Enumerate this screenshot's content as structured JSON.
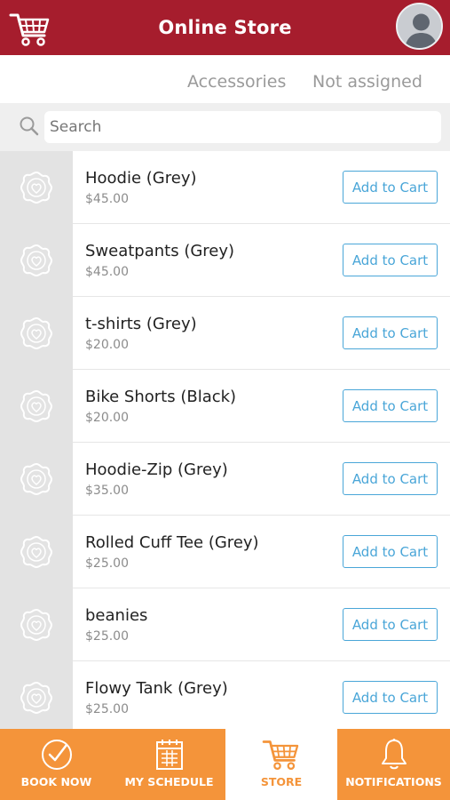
{
  "header": {
    "title": "Online Store",
    "cart_icon": "shopping-cart-icon",
    "avatar_icon": "user-avatar-icon"
  },
  "tabs": [
    {
      "label": "Accessories"
    },
    {
      "label": "Not assigned"
    }
  ],
  "search": {
    "placeholder": "Search",
    "value": "",
    "icon": "search-icon"
  },
  "products": [
    {
      "name": "Hoodie (Grey)",
      "price": "$45.00",
      "button": "Add to Cart"
    },
    {
      "name": "Sweatpants (Grey)",
      "price": "$45.00",
      "button": "Add to Cart"
    },
    {
      "name": "t-shirts (Grey)",
      "price": "$20.00",
      "button": "Add to Cart"
    },
    {
      "name": "Bike Shorts (Black)",
      "price": "$20.00",
      "button": "Add to Cart"
    },
    {
      "name": "Hoodie-Zip (Grey)",
      "price": "$35.00",
      "button": "Add to Cart"
    },
    {
      "name": "Rolled Cuff Tee (Grey)",
      "price": "$25.00",
      "button": "Add to Cart"
    },
    {
      "name": "beanies",
      "price": "$25.00",
      "button": "Add to Cart"
    },
    {
      "name": "Flowy Tank (Grey)",
      "price": "$25.00",
      "button": "Add to Cart"
    }
  ],
  "bottom_nav": [
    {
      "label": "BOOK NOW",
      "icon": "checkmark-circle-icon",
      "active": false
    },
    {
      "label": "MY SCHEDULE",
      "icon": "calendar-icon",
      "active": false
    },
    {
      "label": "STORE",
      "icon": "shopping-cart-icon",
      "active": true
    },
    {
      "label": "NOTIFICATIONS",
      "icon": "bell-icon",
      "active": false
    }
  ],
  "colors": {
    "header_bg": "#a61d2d",
    "nav_bg": "#f4943a",
    "accent_button": "#4aa6d8",
    "thumb_bg": "#e3e3e3"
  }
}
